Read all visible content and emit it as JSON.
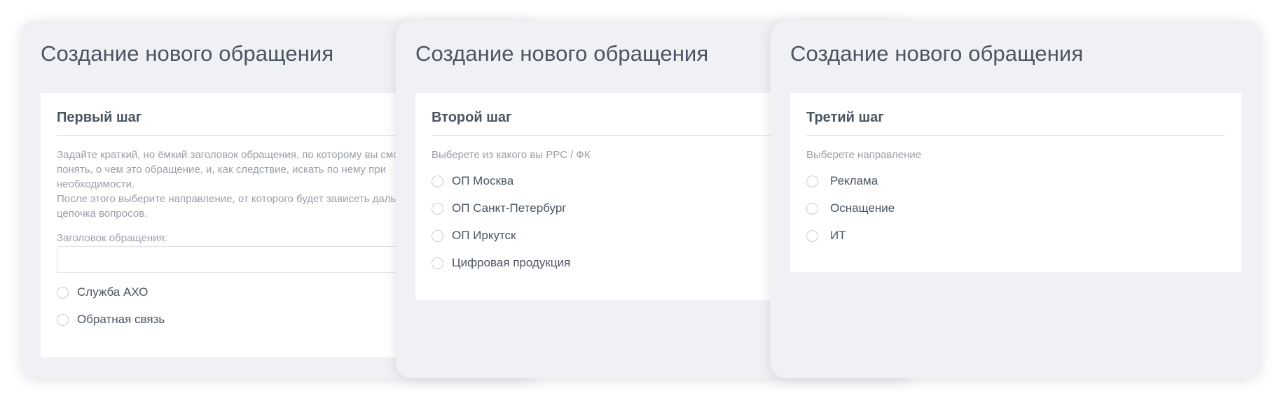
{
  "panels": [
    {
      "title": "Создание нового обращения",
      "step_title": "Первый шаг",
      "hint_lines": [
        "Задайте краткий, но ёмкий заголовок обращения, по которому вы сможете",
        "понять, о чем это обращение, и, как следствие, искать по нему при",
        "необходимости.",
        "После этого выберите направление, от которого будет зависеть дальнейшая",
        "цепочка вопросов."
      ],
      "field_label": "Заголовок обращения:",
      "field_value": "",
      "options": [
        {
          "label": "Служба АХО",
          "selected": false
        },
        {
          "label": "Обратная связь",
          "selected": false
        }
      ]
    },
    {
      "title": "Создание нового обращения",
      "step_title": "Второй шаг",
      "hint": "Выберете из какого вы РРС / ФК",
      "options": [
        {
          "label": "ОП Москва",
          "selected": false
        },
        {
          "label": "ОП Санкт-Петербург",
          "selected": false
        },
        {
          "label": "ОП Иркутск",
          "selected": false
        },
        {
          "label": "Цифровая продукция",
          "selected": false
        }
      ]
    },
    {
      "title": "Создание нового обращения",
      "step_title": "Третий шаг",
      "hint": "Выберете направление",
      "options": [
        {
          "label": "Реклама",
          "selected": false
        },
        {
          "label": "Оснащение",
          "selected": false
        },
        {
          "label": "ИТ",
          "selected": false
        }
      ]
    }
  ],
  "colors": {
    "panel_background": "#eff1f4",
    "card_background": "#ffffff",
    "heading_text": "#4b5461",
    "hint_text": "#9aa0a8",
    "divider": "#dde1e6",
    "radio_border": "#c7ccd2"
  },
  "icons": {
    "radio": "radio-unchecked-icon"
  }
}
